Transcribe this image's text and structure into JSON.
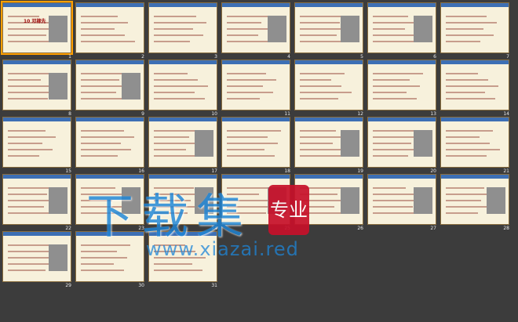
{
  "slides": [
    {
      "n": "1",
      "title": "10 邓稼先"
    },
    {
      "n": "2",
      "title": ""
    },
    {
      "n": "3",
      "title": ""
    },
    {
      "n": "4",
      "title": ""
    },
    {
      "n": "5",
      "title": ""
    },
    {
      "n": "6",
      "title": ""
    },
    {
      "n": "7",
      "title": ""
    },
    {
      "n": "8",
      "title": ""
    },
    {
      "n": "9",
      "title": ""
    },
    {
      "n": "10",
      "title": ""
    },
    {
      "n": "11",
      "title": ""
    },
    {
      "n": "12",
      "title": ""
    },
    {
      "n": "13",
      "title": ""
    },
    {
      "n": "14",
      "title": ""
    },
    {
      "n": "15",
      "title": ""
    },
    {
      "n": "16",
      "title": ""
    },
    {
      "n": "17",
      "title": ""
    },
    {
      "n": "18",
      "title": ""
    },
    {
      "n": "19",
      "title": ""
    },
    {
      "n": "20",
      "title": ""
    },
    {
      "n": "21",
      "title": ""
    },
    {
      "n": "22",
      "title": ""
    },
    {
      "n": "23",
      "title": ""
    },
    {
      "n": "24",
      "title": ""
    },
    {
      "n": "25",
      "title": ""
    },
    {
      "n": "26",
      "title": ""
    },
    {
      "n": "27",
      "title": ""
    },
    {
      "n": "28",
      "title": ""
    },
    {
      "n": "29",
      "title": ""
    },
    {
      "n": "30",
      "title": ""
    },
    {
      "n": "31",
      "title": ""
    }
  ],
  "watermark": {
    "big": "下载集",
    "seal": "专业",
    "url": "www.xiazai.red"
  }
}
